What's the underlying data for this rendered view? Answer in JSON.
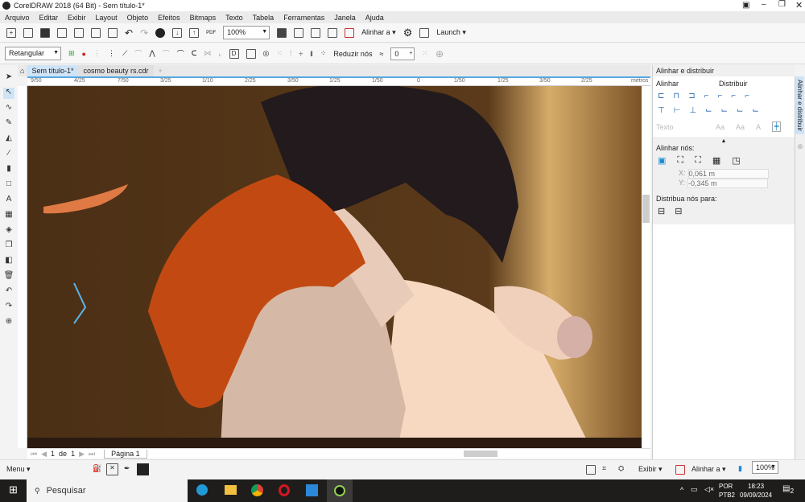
{
  "window": {
    "title": "CorelDRAW 2018 (64 Bit) - Sem título-1*"
  },
  "menu": [
    "Arquivo",
    "Editar",
    "Exibir",
    "Layout",
    "Objeto",
    "Efeitos",
    "Bitmaps",
    "Texto",
    "Tabela",
    "Ferramentas",
    "Janela",
    "Ajuda"
  ],
  "toolbar": {
    "zoom": "100%",
    "align_label": "Alinhar a",
    "launch_label": "Launch"
  },
  "property_bar": {
    "mode": "Retangular",
    "reduce_nodes": "Reduzir nós",
    "curve_smoothness": "0"
  },
  "tabs": [
    "Sem título-1*",
    "cosmo beauty rs.cdr"
  ],
  "ruler": {
    "h_ticks": [
      "9/50",
      "4/25",
      "7/50",
      "3/25",
      "1/10",
      "2/25",
      "3/50",
      "1/25",
      "1/50",
      "0",
      "1/50",
      "1/25",
      "3/50",
      "2/25"
    ],
    "unit": "metros"
  },
  "page_nav": {
    "current": "1",
    "of": "de",
    "total": "1",
    "page_tab": "Página 1"
  },
  "docker": {
    "title": "Alinhar e distribuir",
    "align": "Alinhar",
    "distribute": "Distribuir",
    "text": "Texto",
    "align_nodes": "Alinhar nós:",
    "x_value": "0,061 m",
    "y_value": "-0,345 m",
    "x_label": "X:",
    "y_label": "Y:",
    "distribute_nodes": "Distribua nós para:",
    "side_tab": "Alinhar e distribuir"
  },
  "status": {
    "menu": "Menu",
    "view": "Exibir",
    "align": "Alinhar a",
    "zoom": "100%"
  },
  "taskbar": {
    "search": "Pesquisar",
    "lang1": "POR",
    "lang2": "PTB2",
    "time": "18:23",
    "date": "09/09/2024",
    "notifications": "2"
  }
}
